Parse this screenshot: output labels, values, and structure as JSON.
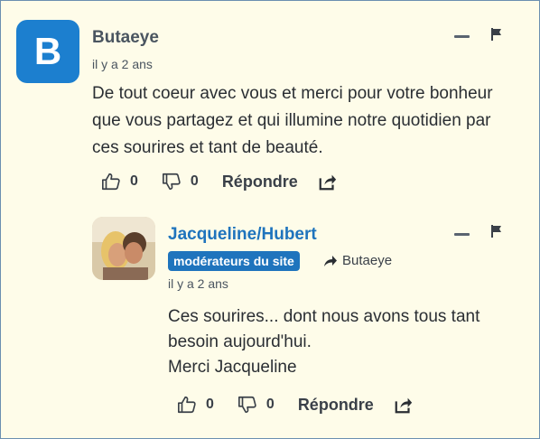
{
  "comment": {
    "avatar_letter": "B",
    "author": "Butaeye",
    "time": "il y a 2 ans",
    "text_lines": [
      "De tout coeur avec vous et merci pour votre bonheur",
      "que vous partagez et qui illumine notre quotidien par",
      "ces sourires et tant de beauté."
    ],
    "likes": "0",
    "dislikes": "0",
    "reply_label": "Répondre"
  },
  "reply": {
    "author": "Jacqueline/Hubert",
    "badge": "modérateurs du site",
    "reply_to": "Butaeye",
    "time": "il y a 2 ans",
    "text_lines": [
      "Ces sourires... dont nous avons tous tant",
      "besoin aujourd'hui.",
      "Merci Jacqueline"
    ],
    "likes": "0",
    "dislikes": "0",
    "reply_label": "Répondre"
  },
  "colors": {
    "background": "#fefce9",
    "accent": "#1f74bd",
    "avatar": "#1c7fcf"
  },
  "icons": [
    "thumbs-up-icon",
    "thumbs-down-icon",
    "share-icon",
    "flag-icon",
    "collapse-icon",
    "reply-arrow-icon"
  ]
}
